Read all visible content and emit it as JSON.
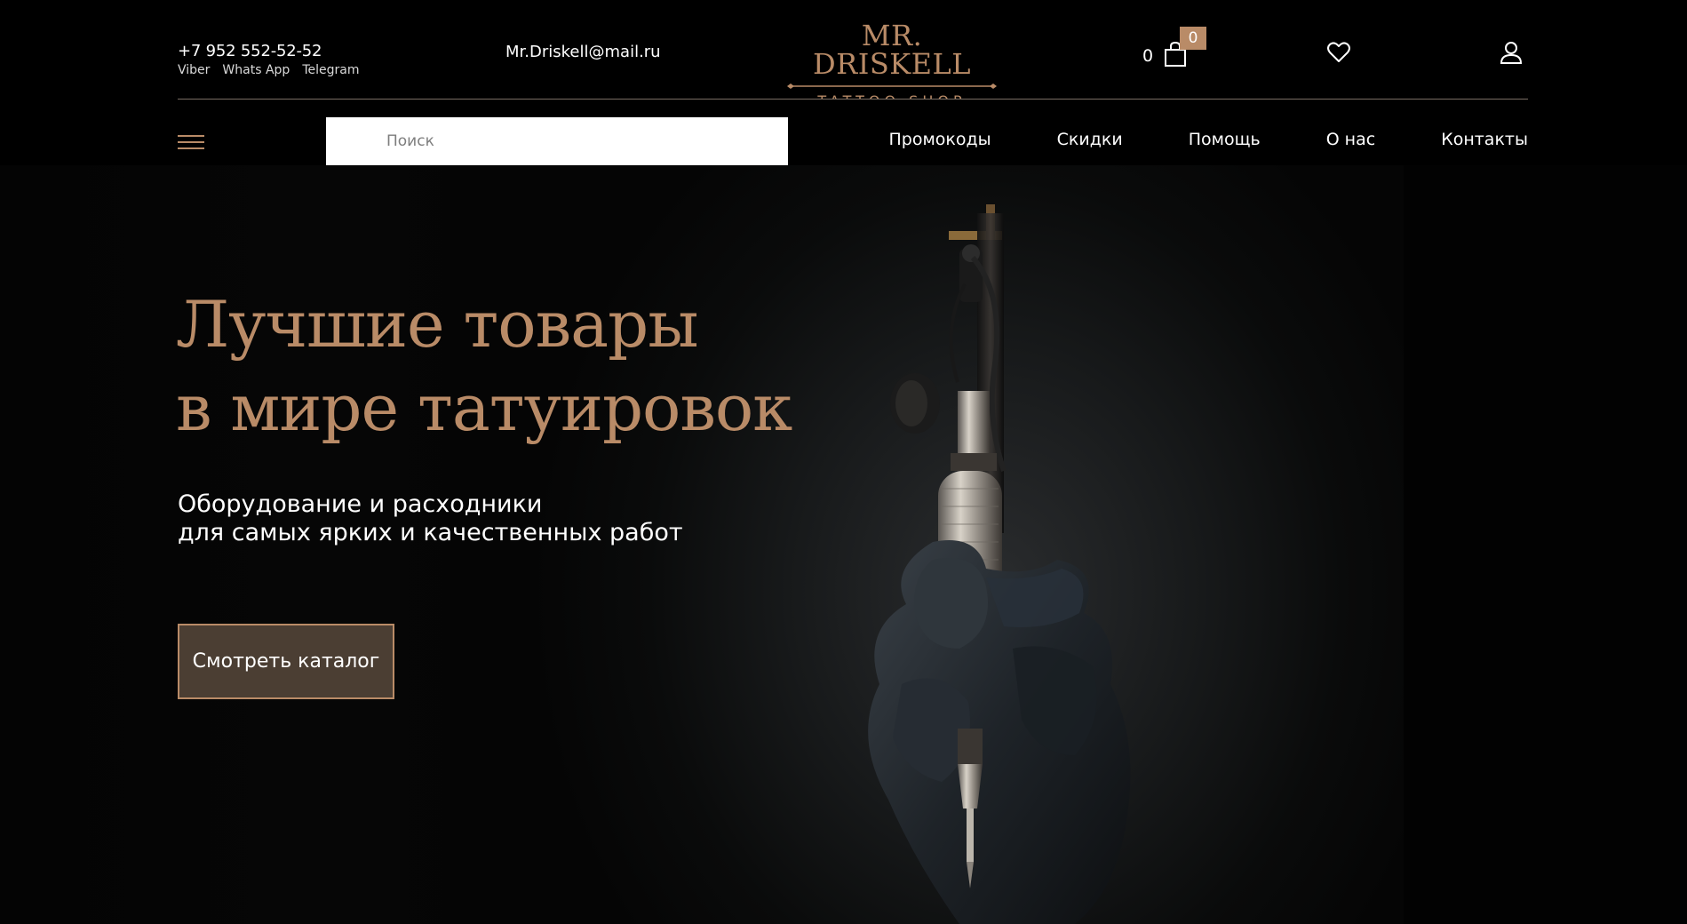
{
  "header": {
    "phone": "+7 952 552-52-52",
    "messengers": [
      "Viber",
      "Whats App",
      "Telegram"
    ],
    "email": "Mr.Driskell@mail.ru",
    "logo": {
      "title": "MR. DRISKELL",
      "subtitle": "TATTOO SHOP"
    },
    "cart": {
      "count": "0",
      "badge": "0"
    },
    "icons": {
      "cart": "shopping-bag-icon",
      "favorites": "heart-icon",
      "account": "user-icon",
      "menu": "hamburger-menu-icon"
    }
  },
  "nav": {
    "search_placeholder": "Поиск",
    "search_value": "",
    "links": [
      "Промокоды",
      "Скидки",
      "Помощь",
      "О нас",
      "Контакты"
    ]
  },
  "hero": {
    "title_lines": [
      "Лучшие товары",
      "в мире татуировок"
    ],
    "subtitle_lines": [
      "Оборудование и расходники",
      "для самых ярких и качественных работ"
    ],
    "cta": "Смотреть каталог"
  },
  "colors": {
    "accent": "#b98b67",
    "background": "#000000",
    "button_fill": "#4b3e33",
    "text": "#ffffff"
  }
}
